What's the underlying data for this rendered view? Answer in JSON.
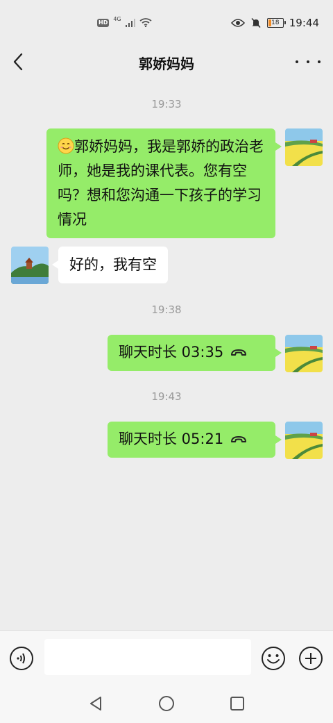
{
  "status_bar": {
    "hd_badge": "HD",
    "network": "4G",
    "battery_level": "18",
    "time": "19:44"
  },
  "header": {
    "title": "郭娇妈妈"
  },
  "messages": [
    {
      "type": "timestamp",
      "text": "19:33"
    },
    {
      "type": "text",
      "from": "me",
      "emoji": "smiling-face",
      "text": "郭娇妈妈，我是郭娇的政治老师，她是我的课代表。您有空吗？想和您沟通一下孩子的学习情况"
    },
    {
      "type": "text",
      "from": "other",
      "text": "好的，我有空"
    },
    {
      "type": "timestamp",
      "text": "19:38"
    },
    {
      "type": "call",
      "from": "me",
      "text": "聊天时长 03:35"
    },
    {
      "type": "timestamp",
      "text": "19:43"
    },
    {
      "type": "call",
      "from": "me",
      "text": "聊天时长 05:21"
    }
  ],
  "input": {
    "value": "",
    "placeholder": ""
  },
  "colors": {
    "sent_bubble": "#95ec69",
    "received_bubble": "#ffffff",
    "background": "#ededed"
  }
}
